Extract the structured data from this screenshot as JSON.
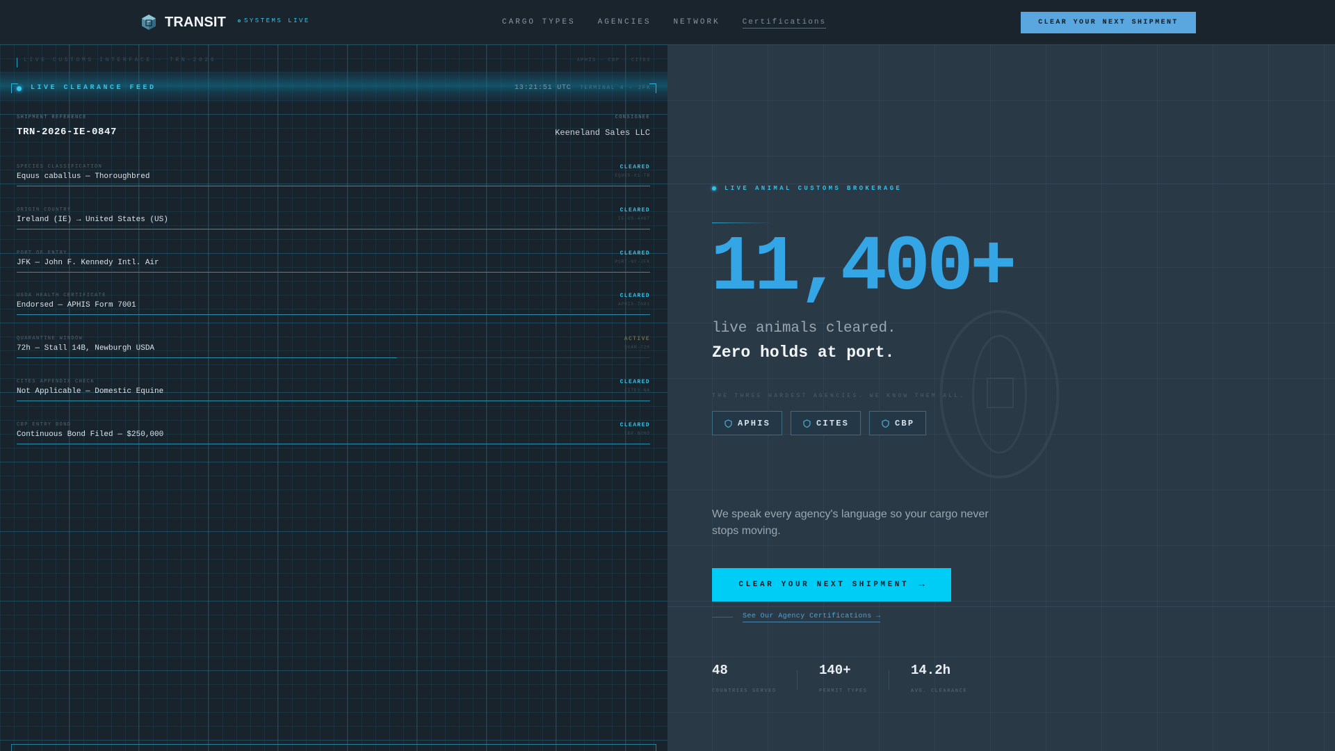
{
  "nav": {
    "logo_text": "TRANSIT",
    "system_status": "SYSTEMS LIVE",
    "links": [
      "CARGO TYPES",
      "AGENCIES",
      "NETWORK",
      "Certifications"
    ],
    "cta": "CLEAR YOUR NEXT SHIPMENT"
  },
  "feed": {
    "interface_label": "LIVE CUSTOMS INTERFACE · TRN-2026",
    "agencies_short": "APHIS · CBP · CITES",
    "title": "LIVE CLEARANCE FEED",
    "time": "13:21:51 UTC",
    "terminal": "TERMINAL 4 · JFK",
    "shipment_reference_label": "SHIPMENT REFERENCE",
    "shipment_reference": "TRN-2026-IE-0847",
    "consignee_label": "CONSIGNEE",
    "consignee": "Keeneland Sales LLC",
    "rows": [
      {
        "label": "SPECIES CLASSIFICATION",
        "value": "Equus caballus — Thoroughbred",
        "status": "CLEARED",
        "code": "EQUUS-01-TB",
        "progress": 1.0
      },
      {
        "label": "ORIGIN COUNTRY",
        "value": "Ireland (IE) → United States (US)",
        "status": "CLEARED",
        "code": "IE-US-4467",
        "progress": 1.0
      },
      {
        "label": "PORT OF ENTRY",
        "value": "JFK — John F. Kennedy Intl. Air",
        "status": "CLEARED",
        "code": "PORT-NY-JFK",
        "progress": 1.0
      },
      {
        "label": "USDA HEALTH CERTIFICATE",
        "value": "Endorsed — APHIS Form 7001",
        "status": "CLEARED",
        "code": "APHIS-7001",
        "progress": 1.0
      },
      {
        "label": "QUARANTINE WINDOW",
        "value": "72h — Stall 14B, Newburgh USDA",
        "status": "ACTIVE",
        "code": "QUAR-72H",
        "progress": 0.6
      },
      {
        "label": "CITES APPENDIX CHECK",
        "value": "Not Applicable — Domestic Equine",
        "status": "CLEARED",
        "code": "CITES-NA",
        "progress": 1.0
      },
      {
        "label": "CBP ENTRY BOND",
        "value": "Continuous Bond Filed — $250,000",
        "status": "CLEARED",
        "code": "CBP-BOND",
        "progress": 1.0
      }
    ]
  },
  "hero": {
    "tag": "LIVE ANIMAL CUSTOMS BROKERAGE",
    "big_number": "11,400+",
    "subtitle_1": "live animals cleared.",
    "subtitle_2": "Zero holds at port.",
    "agencies_label": "THE THREE HARDEST AGENCIES. WE KNOW THEM ALL.",
    "agencies": [
      "APHIS",
      "CITES",
      "CBP"
    ],
    "description": "We speak every agency's language so your cargo never stops moving.",
    "cta": "CLEAR YOUR NEXT SHIPMENT",
    "cta_arrow": "→",
    "secondary_link": "See Our Agency Certifications →",
    "stats": [
      {
        "value": "48",
        "label": "COUNTRIES SERVED"
      },
      {
        "value": "140+",
        "label": "PERMIT TYPES"
      },
      {
        "value": "14.2h",
        "label": "AVG. CLEARANCE"
      }
    ]
  },
  "colors": {
    "accent_cyan": "#00cdf6",
    "accent_blue": "#34a6e6",
    "status_cleared": "#2ec4ea",
    "status_active": "#6e6a45"
  }
}
